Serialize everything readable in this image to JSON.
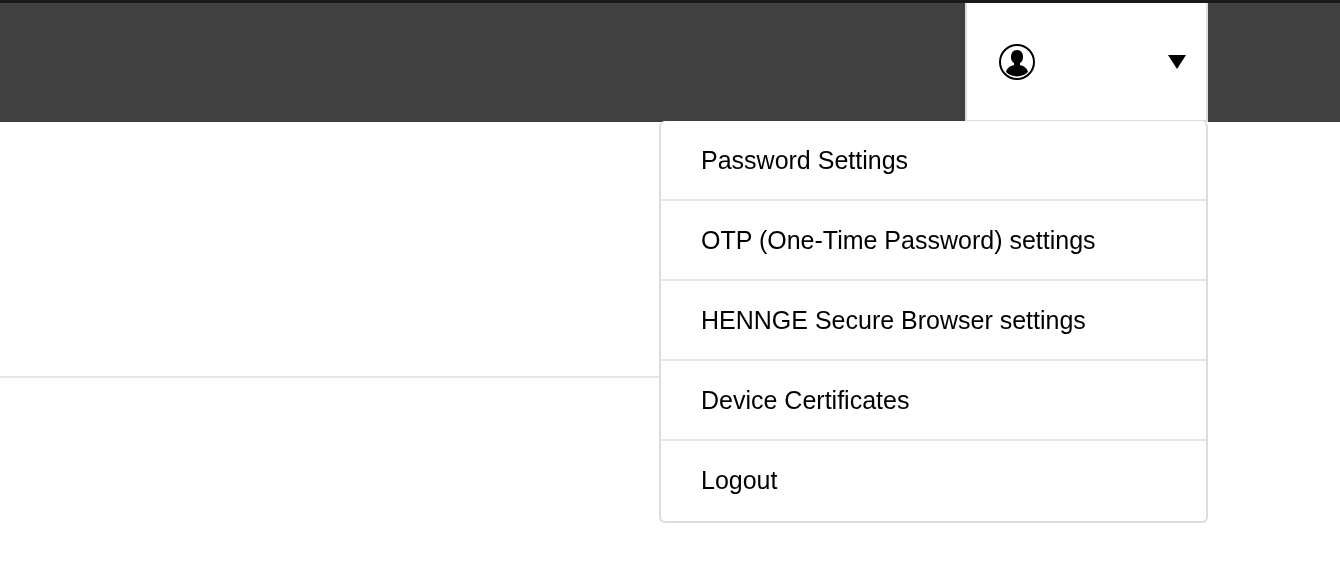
{
  "user_menu": {
    "expanded": true,
    "items": [
      {
        "label": "Password Settings"
      },
      {
        "label": "OTP (One-Time Password) settings"
      },
      {
        "label": "HENNGE Secure Browser settings"
      },
      {
        "label": "Device Certificates"
      },
      {
        "label": "Logout"
      }
    ]
  }
}
